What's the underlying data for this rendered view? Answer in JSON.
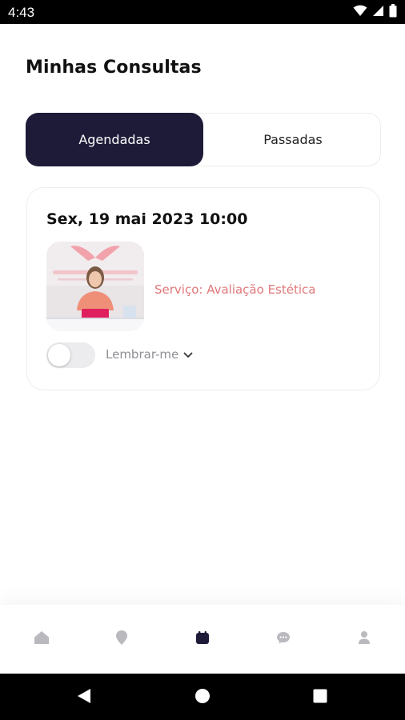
{
  "status_bar": {
    "time": "4:43",
    "icons": [
      "wifi-icon",
      "signal-icon",
      "battery-icon"
    ]
  },
  "page": {
    "title": "Minhas Consultas"
  },
  "tabs": [
    {
      "label": "Agendadas",
      "active": true
    },
    {
      "label": "Passadas",
      "active": false
    }
  ],
  "appointment": {
    "datetime": "Sex, 19 mai 2023 10:00",
    "service": "Serviço: Avaliação Estética",
    "reminder_label": "Lembrar-me",
    "reminder_enabled": false,
    "photo": "clinic-staff-photo"
  },
  "bottom_nav": {
    "items": [
      {
        "icon": "home-icon"
      },
      {
        "icon": "location-pin-icon"
      },
      {
        "icon": "calendar-icon",
        "active": true
      },
      {
        "icon": "chat-icon"
      },
      {
        "icon": "profile-icon"
      }
    ]
  },
  "colors": {
    "primary": "#1d1b38",
    "accent": "#e0787a",
    "inactive_icon": "#b9b9be",
    "muted_text": "#8f8f95"
  }
}
